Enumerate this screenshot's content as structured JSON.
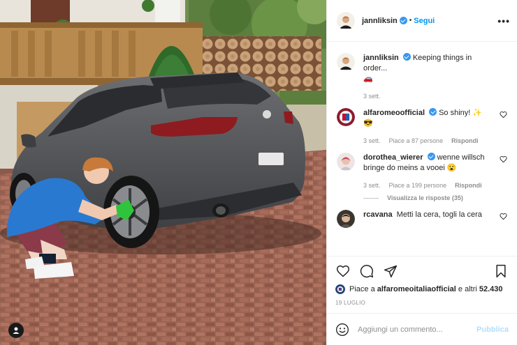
{
  "post": {
    "author": "jannliksin",
    "follow_label": "Segui",
    "more_label": "•••",
    "caption": {
      "user": "jannliksin",
      "text": "Keeping things in order...",
      "emoji": "🚗",
      "time": "3 sett."
    },
    "comments": [
      {
        "user": "alfaromeoofficial",
        "verified": true,
        "text": "So shiny! ✨",
        "emoji": "😎",
        "time": "3 sett.",
        "likes": "Piace a 87 persone",
        "reply_label": "Rispondi"
      },
      {
        "user": "dorothea_wierer",
        "verified": true,
        "text": "wenne willsch bringe do meins a vooei",
        "emoji": "😮",
        "time": "3 sett.",
        "likes": "Piace a 199 persone",
        "reply_label": "Rispondi",
        "view_replies": "Visualizza le risposte (35)"
      },
      {
        "user": "rcavana",
        "verified": false,
        "text": "Metti la cera, togli la cera"
      }
    ],
    "likes_text_prefix": "Piace a ",
    "likes_user": "alfaromeoitaliaofficial",
    "likes_text_middle": " e altri ",
    "likes_count": "52.430",
    "date": "19 LUGLIO",
    "comment_placeholder": "Aggiungi un commento...",
    "publish_label": "Pubblica"
  },
  "colors": {
    "accent": "#0095f6",
    "verified": "#3897f0",
    "publish_disabled": "#b2dffc",
    "muted": "#8e8e8e"
  },
  "icons": [
    "user-tag-icon",
    "verified-icon",
    "heart-icon",
    "comment-icon",
    "share-icon",
    "bookmark-icon",
    "emoji-icon"
  ]
}
